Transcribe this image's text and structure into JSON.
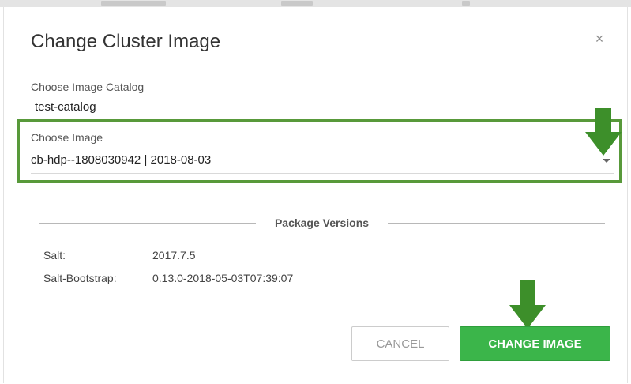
{
  "modal": {
    "title": "Change Cluster Image",
    "close_glyph": "×"
  },
  "image_catalog": {
    "label": "Choose Image Catalog",
    "value": "test-catalog"
  },
  "image": {
    "label": "Choose Image",
    "selected": "cb-hdp--1808030942 | 2018-08-03"
  },
  "package_versions": {
    "title": "Package Versions",
    "items": [
      {
        "name": "Salt:",
        "version": "2017.7.5"
      },
      {
        "name": "Salt-Bootstrap:",
        "version": "0.13.0-2018-05-03T07:39:07"
      }
    ]
  },
  "actions": {
    "cancel_label": "CANCEL",
    "change_label": "CHANGE IMAGE"
  },
  "icons": {
    "close": "close-icon",
    "dropdown": "chevron-down-icon",
    "highlight_arrow": "arrow-down-icon"
  },
  "colors": {
    "primary_green": "#3bb54a",
    "highlight_border": "#58993a",
    "arrow_green": "#3d8f2a"
  }
}
